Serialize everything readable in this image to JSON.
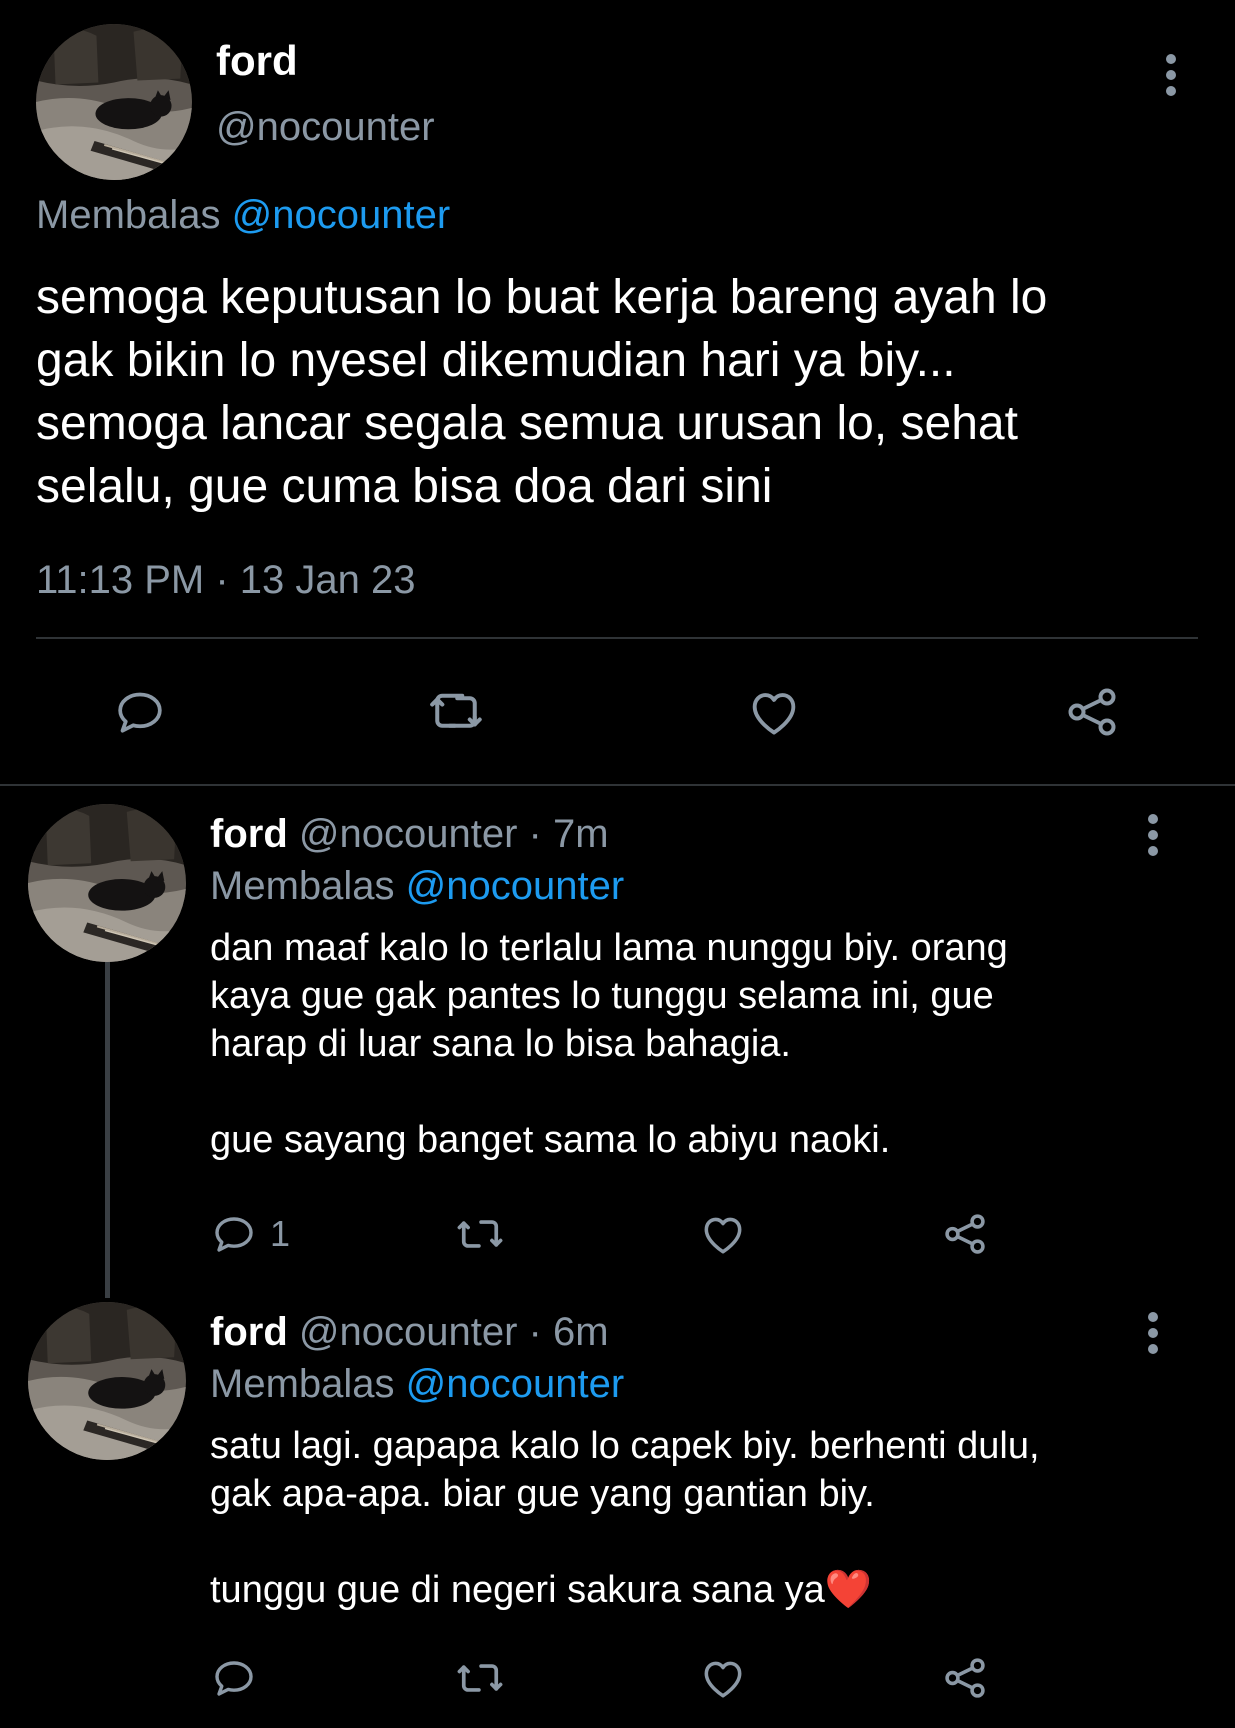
{
  "main_tweet": {
    "display_name": "ford",
    "handle": "@nocounter",
    "replying_label": "Membalas",
    "replying_to": "@nocounter",
    "text": "semoga keputusan lo buat kerja bareng ayah lo\ngak bikin lo nyesel dikemudian hari ya biy...\nsemoga lancar segala semua urusan lo, sehat\nselalu, gue cuma bisa doa dari sini",
    "timestamp": "11:13 PM · 13 Jan 23",
    "actions": [
      "reply-icon",
      "retweet-icon",
      "like-icon",
      "share-icon"
    ]
  },
  "replies": [
    {
      "display_name": "ford",
      "handle": "@nocounter",
      "time": " · 7m",
      "replying_label": "Membalas",
      "replying_to": "@nocounter",
      "text": "dan maaf kalo lo terlalu lama nunggu biy. orang\nkaya gue gak pantes lo tunggu selama ini, gue\nharap di luar sana lo bisa bahagia.\n\ngue sayang banget sama lo abiyu naoki.",
      "reply_count": "1"
    },
    {
      "display_name": "ford",
      "handle": "@nocounter",
      "time": " · 6m",
      "replying_label": "Membalas",
      "replying_to": "@nocounter",
      "text": "satu lagi. gapapa kalo lo capek biy. berhenti dulu,\ngak apa-apa. biar gue yang gantian biy.\n\ntunggu gue di negeri sakura sana ya❤️",
      "reply_count": ""
    }
  ],
  "colors": {
    "background": "#000000",
    "text": "#e7e9ea",
    "muted": "#8b98a5",
    "link": "#1d9bf0",
    "divider": "#2f3336",
    "heart_emoji": "#e0245e"
  }
}
